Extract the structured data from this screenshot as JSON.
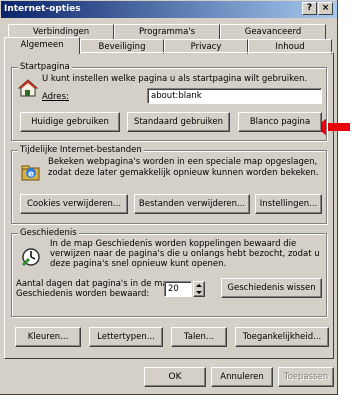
{
  "window": {
    "title": "Internet-opties",
    "help_label": "?",
    "close_label": "×"
  },
  "tabs": {
    "row1": [
      "Verbindingen",
      "Programma's",
      "Geavanceerd"
    ],
    "row2": [
      "Algemeen",
      "Beveiliging",
      "Privacy",
      "Inhoud"
    ],
    "active": "Algemeen"
  },
  "startpagina": {
    "label": "Startpagina",
    "description": "U kunt instellen welke pagina u als startpagina wilt gebruiken.",
    "address_label": "Adres:",
    "address_value": "about:blank",
    "btn_current": "Huidige gebruiken",
    "btn_default": "Standaard gebruiken",
    "btn_blank": "Blanco pagina"
  },
  "temp_files": {
    "label": "Tijdelijke Internet-bestanden",
    "line1": "Bekeken webpagina's worden in een speciale map opgeslagen,",
    "line2": "zodat deze later gemakkelijk opnieuw kunnen worden bekeken.",
    "btn_cookies": "Cookies verwijderen...",
    "btn_files": "Bestanden verwijderen...",
    "btn_settings": "Instellingen..."
  },
  "history": {
    "label": "Geschiedenis",
    "line1": "In de map Geschiedenis worden koppelingen bewaard die",
    "line2": "verwijzen naar de pagina's die u onlangs hebt bezocht, zodat u",
    "line3": "deze pagina's snel opnieuw kunt openen.",
    "days_line1": "Aantal dagen dat pagina's in de map",
    "days_line2": "Geschiedenis worden bewaard:",
    "days_value": "20",
    "btn_clear": "Geschiedenis wissen"
  },
  "bottom_buttons": {
    "colors": "Kleuren...",
    "fonts": "Lettertypen...",
    "languages": "Talen...",
    "accessibility": "Toegankelijkheid..."
  },
  "dialog_buttons": {
    "ok": "OK",
    "cancel": "Annuleren",
    "apply": "Toepassen"
  },
  "colors": {
    "face": "#d4d0c8",
    "titlebar_start": "#0a246a",
    "titlebar_end": "#a6caf0",
    "arrow": "#e8000d"
  }
}
